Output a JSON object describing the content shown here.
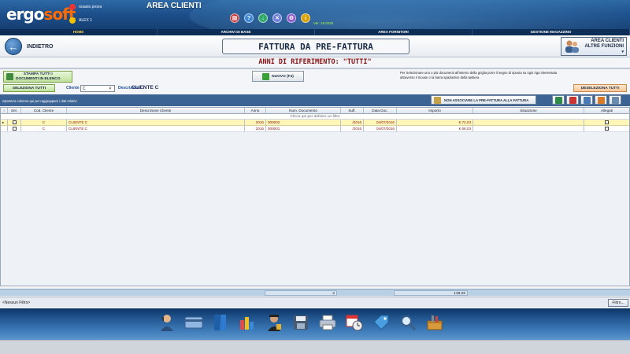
{
  "header": {
    "logo_main": "ergo",
    "logo_accent": "soft",
    "user_name": "rosario prova",
    "user_sub": "ALEX 1",
    "area_title": "AREA CLIENTI",
    "version": "Ver. 16.0030",
    "top_icons": [
      "print-icon",
      "help-icon",
      "download-icon",
      "close-icon",
      "settings-icon",
      "info-icon"
    ]
  },
  "nav": {
    "items": [
      "HOME",
      "ARCHIVI DI BASE",
      "AREA FORNITORI",
      "GESTIONE MAGAZZINO"
    ]
  },
  "titlebar": {
    "back_label": "INDIETRO",
    "title": "FATTURA DA PRE-FATTURA",
    "altre_line1": "AREA CLIENTI",
    "altre_line2": "ALTRE FUNZIONI"
  },
  "anni": "ANNI DI RIFERIMENTO: \"TUTTI\"",
  "toolbar": {
    "stampa_line1": "STAMPA TUTTI I",
    "stampa_line2": "DOCUMENTI IN ELENCO",
    "nuovo_label": "NUOVO (F4)",
    "info_text": "Per Selezionare uno o più documenti all'interno della griglia porre il segno di spunta su ogni riga interessata attraverso il mouse o la barra spaziatrice della tastiera",
    "seleziona_tutti": "SELEZIONA TUTTI",
    "deseleziona_tutti": "DESELEZIONA TUTTI"
  },
  "filters": {
    "cliente_label": "Cliente",
    "cliente_value": "C",
    "descrizione_label": "Descrizione",
    "descrizione_value": "CLIENTE C"
  },
  "grid": {
    "group_hint": "Sposta la colonna qui per raggruppare i dati relativi",
    "non_associare": "NON ASSOCIARE LA PRE-FATTURA ALLA FATTURA",
    "filter_hint": "Clicca qui per definire un filtro",
    "columns": [
      "Sel.",
      "Cod. Cliente",
      "Descrizione Cliente",
      "Anno",
      "Num. Documento",
      "Suff.",
      "Data Doc.",
      "Importo",
      "Situazione",
      "Allegati"
    ],
    "rows": [
      {
        "cod": "C",
        "descrizione": "CLIENTE C",
        "anno": "2016",
        "numero": "000002",
        "suff": "/2016",
        "data": "04/07/2016",
        "importo": "€ 72,03",
        "situazione": ""
      },
      {
        "cod": "C",
        "descrizione": "CLIENTE C",
        "anno": "2016",
        "numero": "000001",
        "suff": "/2016",
        "data": "04/07/2016",
        "importo": "€ 66,03",
        "situazione": ""
      }
    ],
    "total_count": "2",
    "total_amount": "138,06"
  },
  "status": {
    "filter_state": "<Nessun Filtro>",
    "filtro_button": "Filtro..."
  },
  "dock": {
    "icons": [
      "customer-service-icon",
      "credit-card-icon",
      "binders-icon",
      "chart-icon",
      "security-agent-icon",
      "floppy-save-icon",
      "printer-icon",
      "calendar-clock-icon",
      "price-tag-icon",
      "magnifier-icon",
      "toolbox-icon"
    ]
  },
  "colors": {
    "header": "#1c4f8a",
    "nav": "#0d2f57",
    "highlight_row": "#fff6b8",
    "accent_red": "#8a1010",
    "logo_accent": "#ff6a00"
  }
}
